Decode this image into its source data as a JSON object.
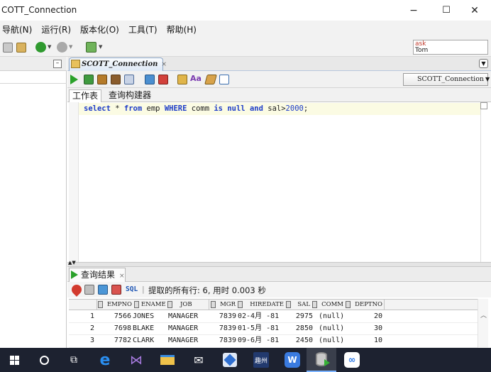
{
  "window": {
    "title": "COTT_Connection",
    "minimize": "−",
    "maximize": "☐",
    "close": "✕"
  },
  "menu": {
    "items": [
      "导航(N)",
      "运行(R)",
      "版本化(O)",
      "工具(T)",
      "帮助(H)"
    ]
  },
  "login": {
    "ask": "ask",
    "user": "Tom"
  },
  "left_panel": {
    "minimize": "–"
  },
  "editor": {
    "tab_label": "SCOTT_Connection",
    "tab_close": "×",
    "connection_select": "SCOTT_Connection",
    "subtabs": [
      "工作表",
      "查询构建器"
    ],
    "sql": {
      "part1": "select",
      "part2": " * ",
      "part3": "from",
      "part4": " emp ",
      "part5": "WHERE",
      "part6": " comm ",
      "part7": "is",
      "part8": " ",
      "part9": "null",
      "part10": " ",
      "part11": "and",
      "part12": " sal>",
      "part13": "2000",
      "part14": ";"
    }
  },
  "results": {
    "tab_label": "查询结果",
    "tab_close": "×",
    "sql_label": "SQL",
    "separator": "|",
    "status": "提取的所有行: 6, 用时 0.003 秒",
    "columns": [
      "EMPNO",
      "ENAME",
      "JOB",
      "MGR",
      "HIREDATE",
      "SAL",
      "COMM",
      "DEPTNO"
    ],
    "rows": [
      {
        "n": "1",
        "empno": "7566",
        "ename": "JONES",
        "job": "MANAGER",
        "mgr": "7839",
        "hiredate": "02-4月 -81",
        "sal": "2975",
        "comm": "(null)",
        "deptno": "20"
      },
      {
        "n": "2",
        "empno": "7698",
        "ename": "BLAKE",
        "job": "MANAGER",
        "mgr": "7839",
        "hiredate": "01-5月 -81",
        "sal": "2850",
        "comm": "(null)",
        "deptno": "30"
      },
      {
        "n": "3",
        "empno": "7782",
        "ename": "CLARK",
        "job": "MANAGER",
        "mgr": "7839",
        "hiredate": "09-6月 -81",
        "sal": "2450",
        "comm": "(null)",
        "deptno": "10"
      }
    ]
  },
  "taskbar": {
    "icons": [
      "windows-start-icon",
      "search-circle-icon",
      "task-view-icon",
      "edge-icon",
      "visual-studio-icon",
      "file-explorer-icon",
      "mail-icon",
      "app-blue-icon",
      "app-tile-icon",
      "wps-icon",
      "sql-developer-icon",
      "baidu-netdisk-icon"
    ],
    "tile_label": "趣州"
  }
}
